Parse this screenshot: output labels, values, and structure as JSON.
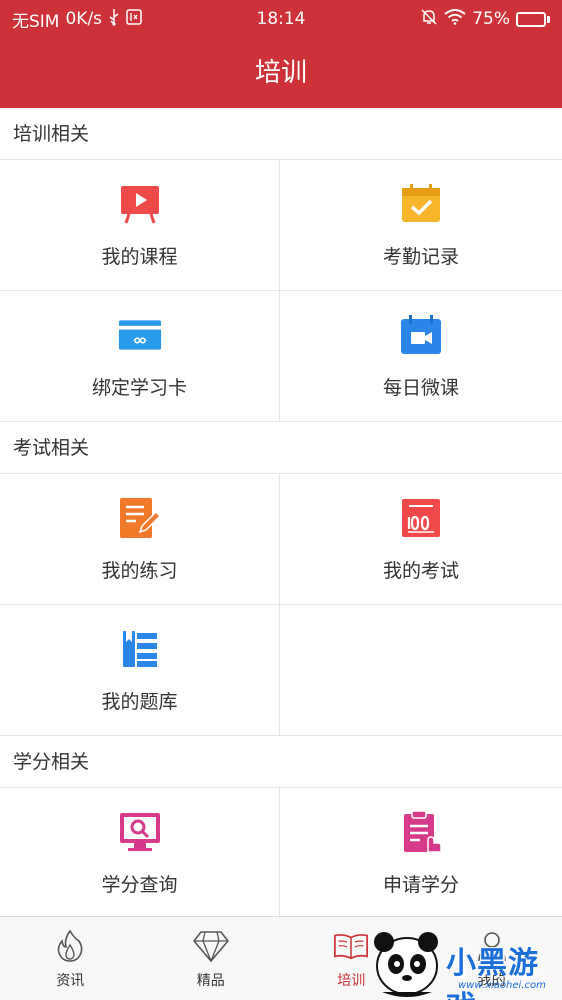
{
  "status_bar": {
    "carrier": "无SIM",
    "speed": "0K/s",
    "time": "18:14",
    "battery": "75%",
    "battery_level": 0.75
  },
  "header": {
    "title": "培训"
  },
  "sections": [
    {
      "title": "培训相关",
      "items": [
        {
          "label": "我的课程",
          "icon": "video-board-icon",
          "color": "#f0494a"
        },
        {
          "label": "考勤记录",
          "icon": "calendar-check-icon",
          "color": "#f7b52b"
        },
        {
          "label": "绑定学习卡",
          "icon": "card-icon",
          "color": "#2a9be8"
        },
        {
          "label": "每日微课",
          "icon": "calendar-video-icon",
          "color": "#2a86e8"
        }
      ]
    },
    {
      "title": "考试相关",
      "items": [
        {
          "label": "我的练习",
          "icon": "edit-paper-icon",
          "color": "#f07a2a"
        },
        {
          "label": "我的考试",
          "icon": "score-100-icon",
          "color": "#f0494a"
        },
        {
          "label": "我的题库",
          "icon": "book-shelf-icon",
          "color": "#2a86e8"
        }
      ]
    },
    {
      "title": "学分相关",
      "items": [
        {
          "label": "学分查询",
          "icon": "monitor-search-icon",
          "color": "#d63a8a"
        },
        {
          "label": "申请学分",
          "icon": "clipboard-hand-icon",
          "color": "#d63a8a"
        }
      ]
    }
  ],
  "tabbar": [
    {
      "label": "资讯",
      "icon": "flame-icon",
      "active": false
    },
    {
      "label": "精品",
      "icon": "diamond-icon",
      "active": false
    },
    {
      "label": "培训",
      "icon": "open-book-icon",
      "active": true
    },
    {
      "label": "我的",
      "icon": "user-icon",
      "active": false
    }
  ],
  "watermark": {
    "text": "小黑游戏",
    "url_text": "www.xiaohei.com"
  }
}
